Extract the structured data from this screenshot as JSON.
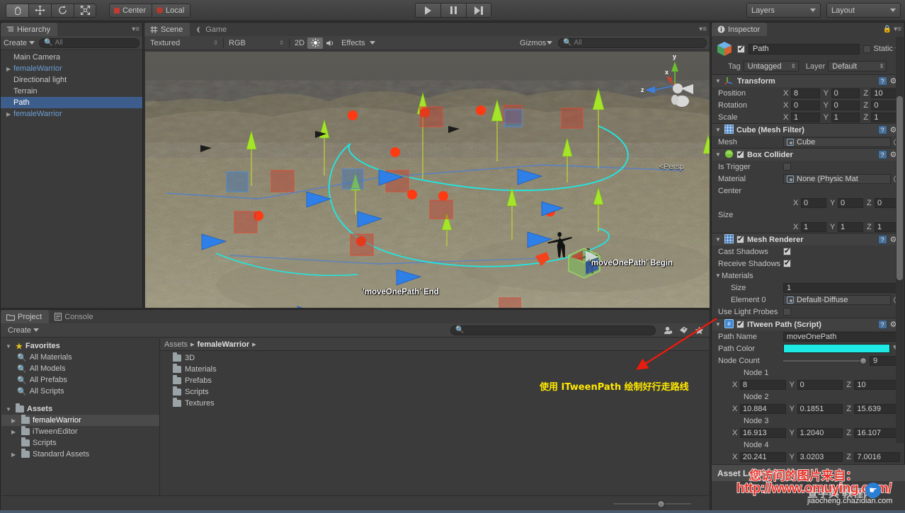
{
  "toolbar": {
    "tools": [
      {
        "name": "hand-tool",
        "glyph": "✋",
        "selected": true
      },
      {
        "name": "move-tool",
        "glyph": "✥",
        "selected": false
      },
      {
        "name": "rotate-tool",
        "glyph": "⟳",
        "selected": false
      },
      {
        "name": "scale-tool",
        "glyph": "⤢",
        "selected": false
      }
    ],
    "pivot_label": "Center",
    "space_label": "Local",
    "play_label": "play",
    "pause_label": "pause",
    "step_label": "step",
    "layers_label": "Layers",
    "layout_label": "Layout"
  },
  "hierarchy": {
    "tab_label": "Hierarchy",
    "create_label": "Create",
    "search_placeholder": "All",
    "items": [
      {
        "label": "Main Camera",
        "prefab": false,
        "expandable": false,
        "selected": false
      },
      {
        "label": "femaleWarrior",
        "prefab": true,
        "expandable": true,
        "selected": false
      },
      {
        "label": "Directional light",
        "prefab": false,
        "expandable": false,
        "selected": false
      },
      {
        "label": "Terrain",
        "prefab": false,
        "expandable": false,
        "selected": false
      },
      {
        "label": "Path",
        "prefab": false,
        "expandable": false,
        "selected": true
      },
      {
        "label": "femaleWarrior",
        "prefab": true,
        "expandable": true,
        "selected": false
      }
    ]
  },
  "scene": {
    "tab_scene": "Scene",
    "tab_game": "Game",
    "draw_mode": "Textured",
    "color_mode": "RGB",
    "toggle_2d": "2D",
    "light_icon": "light-icon",
    "audio_icon": "audio-icon",
    "effects_label": "Effects",
    "gizmos_label": "Gizmos",
    "gizmo_search_placeholder": "All",
    "persp_label": "Persp",
    "axis_x": "x",
    "axis_y": "y",
    "axis_z": "z",
    "label_begin": "'moveOnePath' Begin",
    "label_end": "'moveOnePath' End"
  },
  "project": {
    "tab_project": "Project",
    "tab_console": "Console",
    "create_label": "Create",
    "search_placeholder": "",
    "favorites_label": "Favorites",
    "favorites": [
      "All Materials",
      "All Models",
      "All Prefabs",
      "All Scripts"
    ],
    "assets_label": "Assets",
    "asset_tree": [
      {
        "label": "femaleWarrior",
        "expandable": true,
        "selected": true
      },
      {
        "label": "iTweenEditor",
        "expandable": true,
        "selected": false
      },
      {
        "label": "Scripts",
        "expandable": false,
        "selected": false
      },
      {
        "label": "Standard Assets",
        "expandable": true,
        "selected": false
      }
    ],
    "breadcrumb": [
      "Assets",
      "femaleWarrior"
    ],
    "folders": [
      "3D",
      "Materials",
      "Prefabs",
      "Scripts",
      "Textures"
    ]
  },
  "inspector": {
    "tab_label": "Inspector",
    "object_name": "Path",
    "object_enabled": true,
    "static_label": "Static",
    "tag_label": "Tag",
    "tag_value": "Untagged",
    "layer_label": "Layer",
    "layer_value": "Default",
    "components": [
      {
        "title": "Transform",
        "rows": [
          {
            "label": "Position",
            "type": "vector3",
            "x": "8",
            "y": "0",
            "z": "10"
          },
          {
            "label": "Rotation",
            "type": "vector3",
            "x": "0",
            "y": "0",
            "z": "0"
          },
          {
            "label": "Scale",
            "type": "vector3",
            "x": "1",
            "y": "1",
            "z": "1"
          }
        ]
      },
      {
        "title": "Cube (Mesh Filter)",
        "rows": [
          {
            "label": "Mesh",
            "type": "object",
            "value": "Cube"
          }
        ]
      },
      {
        "title": "Box Collider",
        "enabled": true,
        "rows": [
          {
            "label": "Is Trigger",
            "type": "checkbox",
            "value": false
          },
          {
            "label": "Material",
            "type": "object",
            "value": "None (Physic Mat"
          },
          {
            "label": "Center",
            "type": "label"
          },
          {
            "label": "",
            "type": "vector3",
            "x": "0",
            "y": "0",
            "z": "0"
          },
          {
            "label": "Size",
            "type": "label"
          },
          {
            "label": "",
            "type": "vector3",
            "x": "1",
            "y": "1",
            "z": "1"
          }
        ]
      },
      {
        "title": "Mesh Renderer",
        "enabled": true,
        "rows": [
          {
            "label": "Cast Shadows",
            "type": "checkbox",
            "value": true
          },
          {
            "label": "Receive Shadows",
            "type": "checkbox",
            "value": true
          },
          {
            "label": "Materials",
            "type": "foldout"
          },
          {
            "label": "Size",
            "type": "text",
            "value": "1",
            "indent": true
          },
          {
            "label": "Element 0",
            "type": "object",
            "value": "Default-Diffuse",
            "indent": true
          },
          {
            "label": "Use Light Probes",
            "type": "checkbox",
            "value": false
          }
        ]
      },
      {
        "title": "ITween Path (Script)",
        "enabled": true,
        "rows": [
          {
            "label": "Path Name",
            "type": "text",
            "value": "moveOnePath"
          },
          {
            "label": "Path Color",
            "type": "color",
            "value": "#1ee9e4"
          },
          {
            "label": "Node Count",
            "type": "slider",
            "value": "9"
          }
        ]
      }
    ],
    "nodes": [
      {
        "label": "Node 1",
        "x": "8",
        "y": "0",
        "z": "10"
      },
      {
        "label": "Node 2",
        "x": "10.884",
        "y": "0.1851",
        "z": "15.639"
      },
      {
        "label": "Node 3",
        "x": "16.913",
        "y": "1.2040",
        "z": "16.107"
      },
      {
        "label": "Node 4",
        "x": "20.241",
        "y": "3.0203",
        "z": "7.0016"
      }
    ],
    "asset_label_title": "Asset Label"
  },
  "annotation": {
    "text": "使用 ITweenPath 绘制好行走路线",
    "color": "#ffe800",
    "arrow_color": "#e81b0f"
  },
  "watermark": {
    "line1": "您访问的图片来自：",
    "line2": "http://www.omuying.com/",
    "line3": "jiaocheng.chazidian.com",
    "site": "查字典 教程网"
  }
}
